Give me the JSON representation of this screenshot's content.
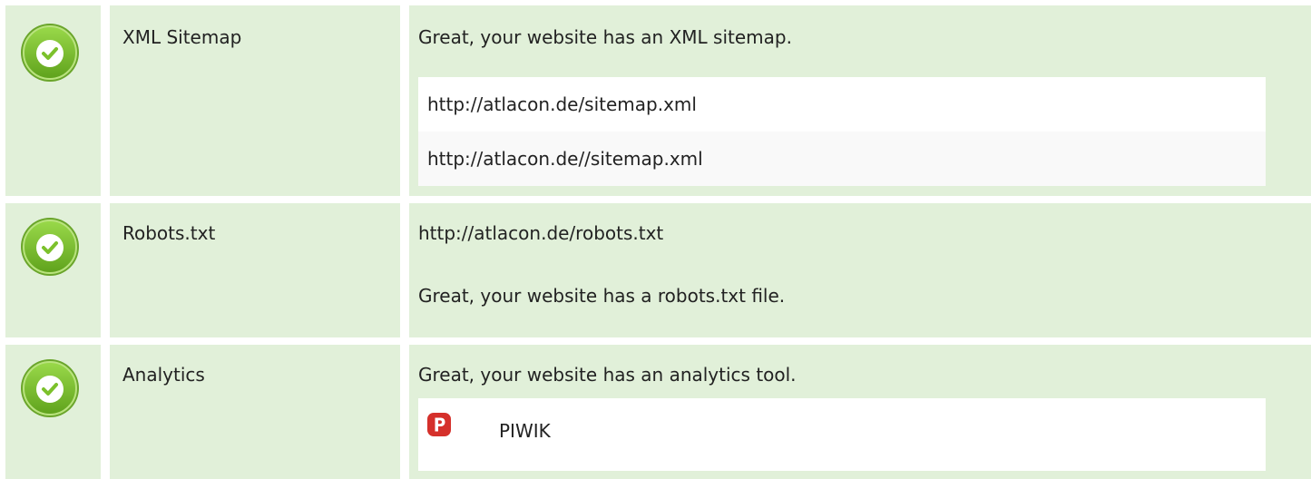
{
  "rows": [
    {
      "label": "XML Sitemap",
      "status": "passed",
      "message": "Great, your website has an XML sitemap.",
      "urls": [
        "http://atlacon.de/sitemap.xml",
        "http://atlacon.de//sitemap.xml"
      ]
    },
    {
      "label": "Robots.txt",
      "status": "passed",
      "url": "http://atlacon.de/robots.txt",
      "message": "Great, your website has a robots.txt file."
    },
    {
      "label": "Analytics",
      "status": "passed",
      "message": "Great, your website has an analytics tool.",
      "tools": [
        {
          "name": "PIWIK",
          "icon": "piwik-logo-icon"
        }
      ]
    }
  ],
  "colors": {
    "row_background": "#e1f0d9",
    "check_green": "#7cc12c",
    "piwik_red": "#d5302b",
    "list_alt_background": "#f9f9f9"
  },
  "icons": {
    "status_passed": "check-circle-icon"
  }
}
